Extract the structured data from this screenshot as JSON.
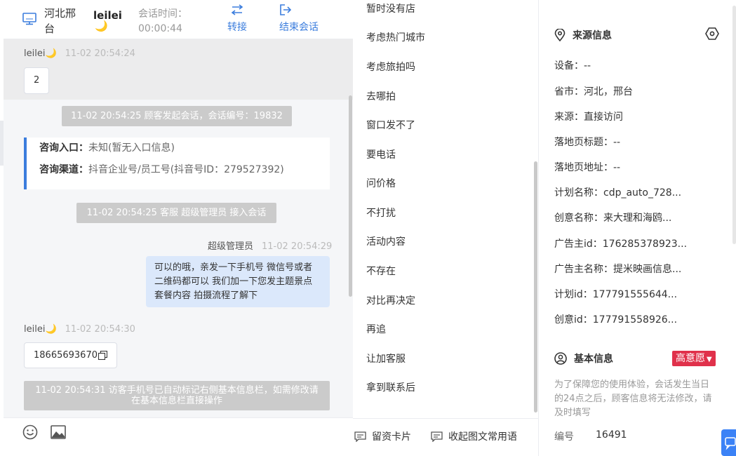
{
  "header": {
    "location": "河北邢台",
    "visitor_name": "leilei",
    "moon_emoji": "🌙",
    "session_time_label": "会话时间：",
    "session_time": "00:00:44",
    "transfer_label": "转接",
    "end_label": "结束会话"
  },
  "messages": {
    "m1_name": "leilei🌙",
    "m1_time": "11-02 20:54:24",
    "m1_text": "2",
    "sys1": "11-02 20:54:25 顾客发起会话，会话编号：19832",
    "entry_label": "咨询入口：",
    "entry_value": "未知(暂无入口信息)",
    "channel_label": "咨询渠道：",
    "channel_value": "抖音企业号/员工号(抖音号ID：279527392)",
    "sys2": "11-02 20:54:25 客服 超级管理员 接入会话",
    "agent_name": "超级管理员",
    "agent_time": "11-02 20:54:29",
    "agent_text": "可以的哦，亲发一下手机号 微信号或者二维码都可以 我们加一下您发主题景点 套餐内容 拍摄流程了解下",
    "m2_name": "leilei🌙",
    "m2_time": "11-02 20:54:30",
    "m2_phone": "18665693670",
    "sys3": "11-02 20:54:31 访客手机号已自动标记右侧基本信息栏，如需修改请在基本信息栏直接操作"
  },
  "footer_icons": [
    "emoji-icon",
    "image-icon"
  ],
  "quick_replies": [
    "暂时没有店",
    "考虑热门城市",
    "考虑旅拍吗",
    "去哪拍",
    "窗口发不了",
    "要电话",
    "问价格",
    "不打扰",
    "活动内容",
    "不存在",
    "对比再决定",
    "再追",
    "让加客服",
    "拿到联系后"
  ],
  "quick_footer": {
    "card_label": "留资卡片",
    "fold_label": "收起图文常用语"
  },
  "source": {
    "title": "来源信息",
    "device": "设备：--",
    "province": "省市：河北，邢台",
    "origin": "来源：直接访问",
    "landing_title": "落地页标题：--",
    "landing_url": "落地页地址：--",
    "plan_name": "计划名称：cdp_auto_728...",
    "creative_name": "创意名称：来大理和海鸥...",
    "advertiser_id": "广告主id：176285378923...",
    "advertiser_name": "广告主名称：提米映画信息...",
    "plan_id": "计划id：177791555644...",
    "creative_id": "创意id：177791558926..."
  },
  "basic": {
    "title": "基本信息",
    "intent": "高意愿",
    "notice": "为了保障您的使用体验，会话发生当日的24点之后，顾客信息将无法修改，请及时填写",
    "number_label": "编号",
    "number_value": "16491"
  },
  "colors": {
    "accent": "#3b7ddd",
    "agent_bubble": "#dbe8fb",
    "system_message": "#cbcbcb",
    "intent_badge": "#e0314b"
  }
}
